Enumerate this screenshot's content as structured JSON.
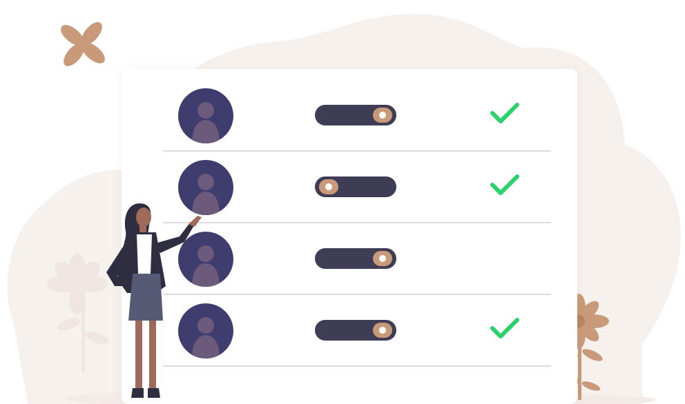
{
  "illustration": {
    "rows": [
      {
        "toggle_on": true,
        "checked": true
      },
      {
        "toggle_on": false,
        "checked": true
      },
      {
        "toggle_on": true,
        "checked": false
      },
      {
        "toggle_on": true,
        "checked": true
      }
    ],
    "icons": {
      "avatar": "user-silhouette-icon",
      "check": "check-mark-icon",
      "toggle": "toggle-switch"
    },
    "colors": {
      "blob": "#f7f1ee",
      "avatar": "#3f3d6e",
      "silhouette": "#6b5a7a",
      "toggle_track": "#3f3d56",
      "toggle_knob": "#c99a7a",
      "check": "#2bd16b",
      "flower": "#c99a7a",
      "flower_faded": "#efe6e1",
      "divider": "#dcdcdc",
      "skin": "#a06a5a",
      "hair": "#2f2e41",
      "jacket": "#2f2e41",
      "skirt": "#575a75"
    }
  }
}
